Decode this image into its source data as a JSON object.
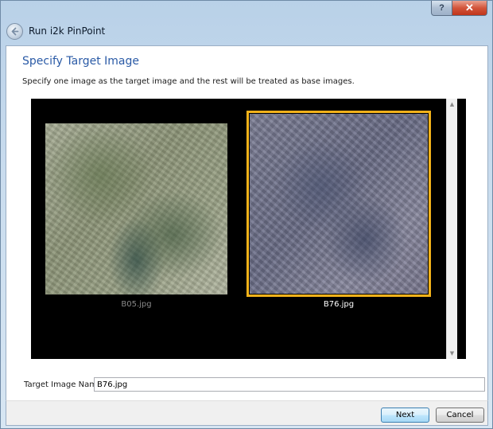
{
  "window": {
    "title": "Run i2k PinPoint",
    "help_label": "?",
    "close_label": "✕"
  },
  "page": {
    "heading": "Specify Target Image",
    "instructions": "Specify one image as the target image and the rest will be treated as base images."
  },
  "images": [
    {
      "name": "B05.jpg",
      "selected": false
    },
    {
      "name": "B76.jpg",
      "selected": true
    }
  ],
  "target": {
    "label": "Target Image Name:",
    "value": "B76.jpg"
  },
  "buttons": {
    "next": "Next",
    "cancel": "Cancel"
  },
  "colors": {
    "heading": "#2a5aa6",
    "selection": "#f2b21a",
    "viewer_background": "#000000"
  },
  "icons": {
    "back": "back-arrow-icon",
    "scroll_up": "scroll-up-arrow-icon",
    "scroll_down": "scroll-down-arrow-icon"
  }
}
